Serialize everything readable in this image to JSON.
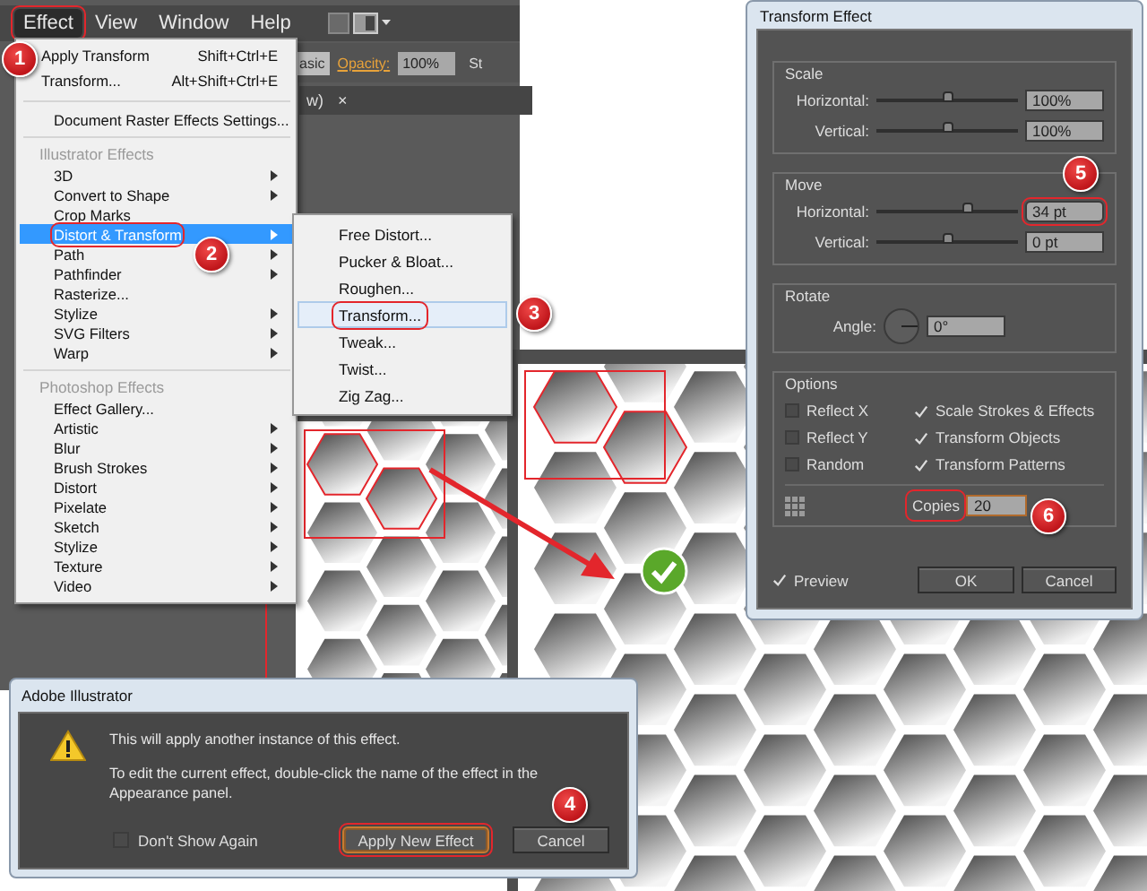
{
  "menu_bar": {
    "items": [
      {
        "label": "Effect",
        "selected": true,
        "outlined": true
      },
      {
        "label": "View",
        "selected": false,
        "outlined": false
      },
      {
        "label": "Window",
        "selected": false,
        "outlined": false
      },
      {
        "label": "Help",
        "selected": false,
        "outlined": false
      }
    ]
  },
  "control_bar": {
    "style_value": "asic",
    "opacity_label": "Opacity:",
    "opacity_value": "100%",
    "cut_label": "St"
  },
  "document_tab": {
    "label": "w)",
    "close": "×"
  },
  "effect_menu": {
    "items": [
      {
        "kind": "item",
        "label": "Apply Transform",
        "shortcut": "Shift+Ctrl+E",
        "submenu": false,
        "selected": false,
        "outlined": false
      },
      {
        "kind": "item",
        "label": "Transform...",
        "shortcut": "Alt+Shift+Ctrl+E",
        "submenu": false,
        "selected": false,
        "outlined": false
      },
      {
        "kind": "separator"
      },
      {
        "kind": "item",
        "label": "Document Raster Effects Settings...",
        "submenu": false,
        "selected": false,
        "outlined": false
      },
      {
        "kind": "separator"
      },
      {
        "kind": "header",
        "label": "Illustrator Effects"
      },
      {
        "kind": "item",
        "label": "3D",
        "submenu": true,
        "selected": false,
        "outlined": false
      },
      {
        "kind": "item",
        "label": "Convert to Shape",
        "submenu": true,
        "selected": false,
        "outlined": false
      },
      {
        "kind": "item",
        "label": "Crop Marks",
        "submenu": false,
        "selected": false,
        "outlined": false
      },
      {
        "kind": "item",
        "label": "Distort & Transform",
        "submenu": true,
        "selected": true,
        "outlined": true
      },
      {
        "kind": "item",
        "label": "Path",
        "submenu": true,
        "selected": false,
        "outlined": false
      },
      {
        "kind": "item",
        "label": "Pathfinder",
        "submenu": true,
        "selected": false,
        "outlined": false
      },
      {
        "kind": "item",
        "label": "Rasterize...",
        "submenu": false,
        "selected": false,
        "outlined": false
      },
      {
        "kind": "item",
        "label": "Stylize",
        "submenu": true,
        "selected": false,
        "outlined": false
      },
      {
        "kind": "item",
        "label": "SVG Filters",
        "submenu": true,
        "selected": false,
        "outlined": false
      },
      {
        "kind": "item",
        "label": "Warp",
        "submenu": true,
        "selected": false,
        "outlined": false
      },
      {
        "kind": "separator"
      },
      {
        "kind": "header",
        "label": "Photoshop Effects"
      },
      {
        "kind": "item",
        "label": "Effect Gallery...",
        "submenu": false,
        "selected": false,
        "outlined": false
      },
      {
        "kind": "item",
        "label": "Artistic",
        "submenu": true,
        "selected": false,
        "outlined": false
      },
      {
        "kind": "item",
        "label": "Blur",
        "submenu": true,
        "selected": false,
        "outlined": false
      },
      {
        "kind": "item",
        "label": "Brush Strokes",
        "submenu": true,
        "selected": false,
        "outlined": false
      },
      {
        "kind": "item",
        "label": "Distort",
        "submenu": true,
        "selected": false,
        "outlined": false
      },
      {
        "kind": "item",
        "label": "Pixelate",
        "submenu": true,
        "selected": false,
        "outlined": false
      },
      {
        "kind": "item",
        "label": "Sketch",
        "submenu": true,
        "selected": false,
        "outlined": false
      },
      {
        "kind": "item",
        "label": "Stylize",
        "submenu": true,
        "selected": false,
        "outlined": false
      },
      {
        "kind": "item",
        "label": "Texture",
        "submenu": true,
        "selected": false,
        "outlined": false
      },
      {
        "kind": "item",
        "label": "Video",
        "submenu": true,
        "selected": false,
        "outlined": false
      }
    ]
  },
  "submenu": {
    "items": [
      {
        "label": "Free Distort...",
        "selected": false,
        "outlined": false
      },
      {
        "label": "Pucker & Bloat...",
        "selected": false,
        "outlined": false
      },
      {
        "label": "Roughen...",
        "selected": false,
        "outlined": false
      },
      {
        "label": "Transform...",
        "selected": true,
        "outlined": true
      },
      {
        "label": "Tweak...",
        "selected": false,
        "outlined": false
      },
      {
        "label": "Twist...",
        "selected": false,
        "outlined": false
      },
      {
        "label": "Zig Zag...",
        "selected": false,
        "outlined": false
      }
    ]
  },
  "transform_dialog": {
    "title": "Transform Effect",
    "groups": [
      {
        "kind": "sliders",
        "title": "Scale",
        "rows": [
          {
            "label": "Horizontal:",
            "level": 0.5,
            "value": "100%",
            "outlined": false
          },
          {
            "label": "Vertical:",
            "level": 0.5,
            "value": "100%",
            "outlined": false
          }
        ]
      },
      {
        "kind": "sliders",
        "title": "Move",
        "rows": [
          {
            "label": "Horizontal:",
            "level": 0.65,
            "value": "34 pt",
            "outlined": true
          },
          {
            "label": "Vertical:",
            "level": 0.5,
            "value": "0 pt",
            "outlined": false
          }
        ]
      },
      {
        "kind": "angle",
        "title": "Rotate",
        "label": "Angle:",
        "value": "0°"
      },
      {
        "kind": "options",
        "title": "Options",
        "checkboxes": [
          {
            "label": "Reflect X",
            "checked": false
          },
          {
            "label": "Scale Strokes & Effects",
            "checked": true
          },
          {
            "label": "Reflect Y",
            "checked": false
          },
          {
            "label": "Transform Objects",
            "checked": true
          },
          {
            "label": "Random",
            "checked": false
          },
          {
            "label": "Transform Patterns",
            "checked": true
          }
        ],
        "copies_label": "Copies",
        "copies_value": "20",
        "copies_outlined": true
      }
    ],
    "preview": {
      "label": "Preview",
      "checked": true
    },
    "buttons": [
      {
        "label": "OK",
        "outlined": false
      },
      {
        "label": "Cancel",
        "outlined": false
      }
    ]
  },
  "alert_dialog": {
    "title": "Adobe Illustrator",
    "message": "This will apply another instance of this effect.",
    "detail": "To edit the current effect, double-click the name of the effect in the Appearance panel.",
    "checkbox": {
      "label": "Don't Show Again",
      "checked": false
    },
    "buttons": [
      {
        "label": "Apply New Effect",
        "default": true,
        "outlined": true
      },
      {
        "label": "Cancel",
        "default": false,
        "outlined": false
      }
    ]
  },
  "callouts": [
    {
      "label": "1"
    },
    {
      "label": "2"
    },
    {
      "label": "3"
    },
    {
      "label": "4"
    },
    {
      "label": "5"
    },
    {
      "label": "6"
    }
  ]
}
